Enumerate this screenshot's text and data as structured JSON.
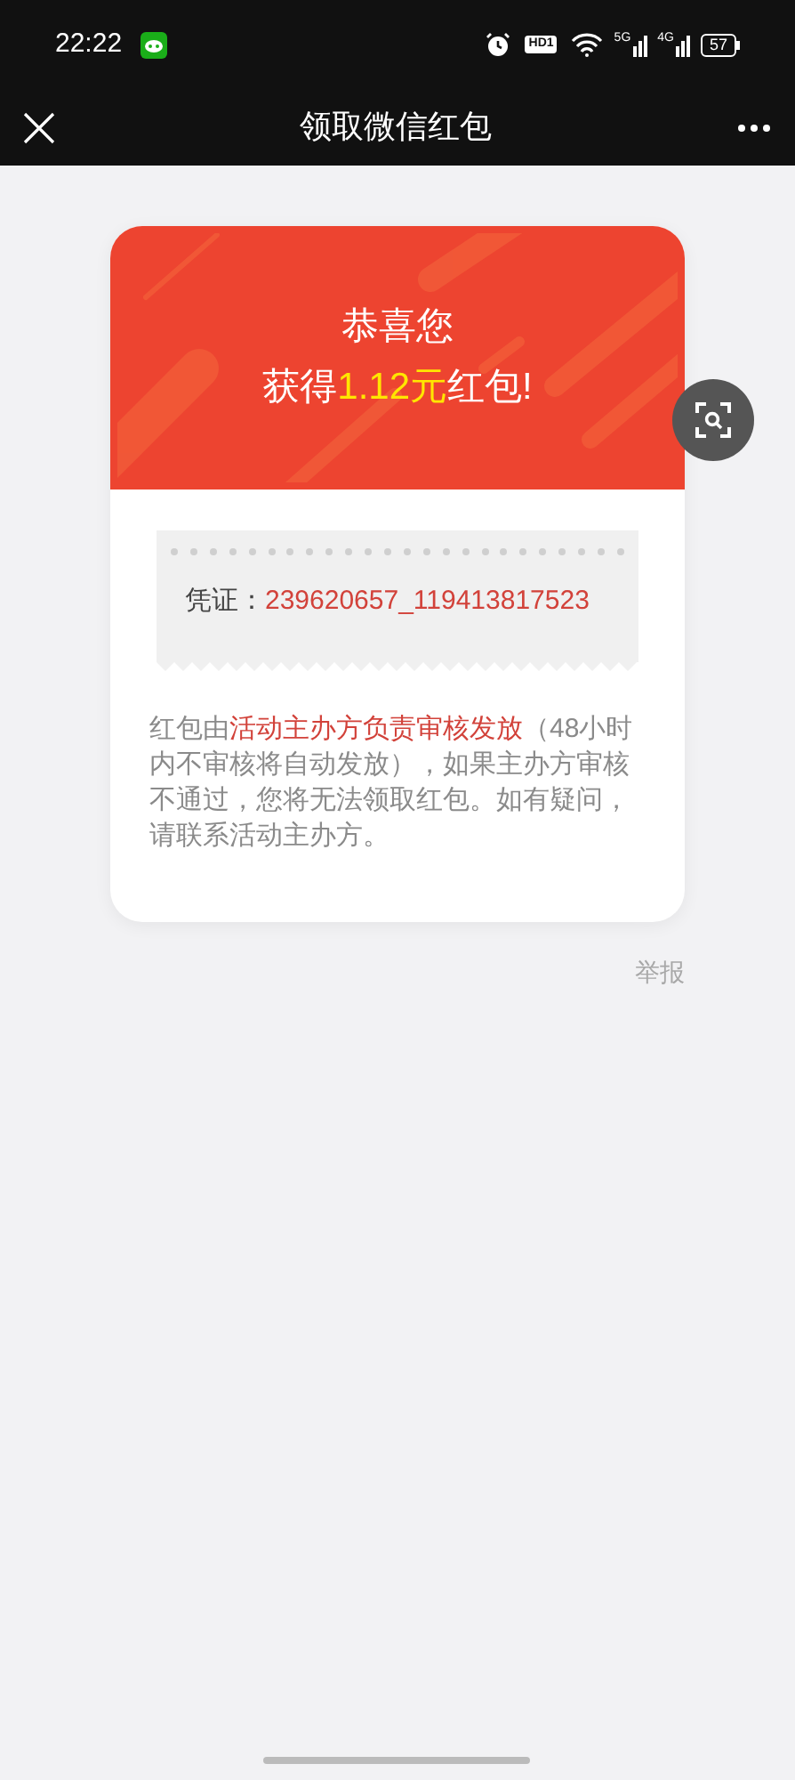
{
  "status_bar": {
    "time": "22:22",
    "hd_label": "HD1",
    "signals": [
      {
        "label": "5G"
      },
      {
        "label": "4G"
      }
    ],
    "battery": "57"
  },
  "nav_bar": {
    "title": "领取微信红包"
  },
  "banner": {
    "greeting": "恭喜您",
    "prize_prefix": "获得",
    "prize_amount": "1.12元",
    "prize_suffix": "红包!"
  },
  "voucher": {
    "label": "凭证：",
    "code": "239620657_119413817523"
  },
  "notice": {
    "before": "红包由",
    "highlight": "活动主办方负责审核发放",
    "after": "（48小时内不审核将自动发放），如果主办方审核不通过，您将无法领取红包。如有疑问，请联系活动主办方。"
  },
  "report_link": "举报"
}
